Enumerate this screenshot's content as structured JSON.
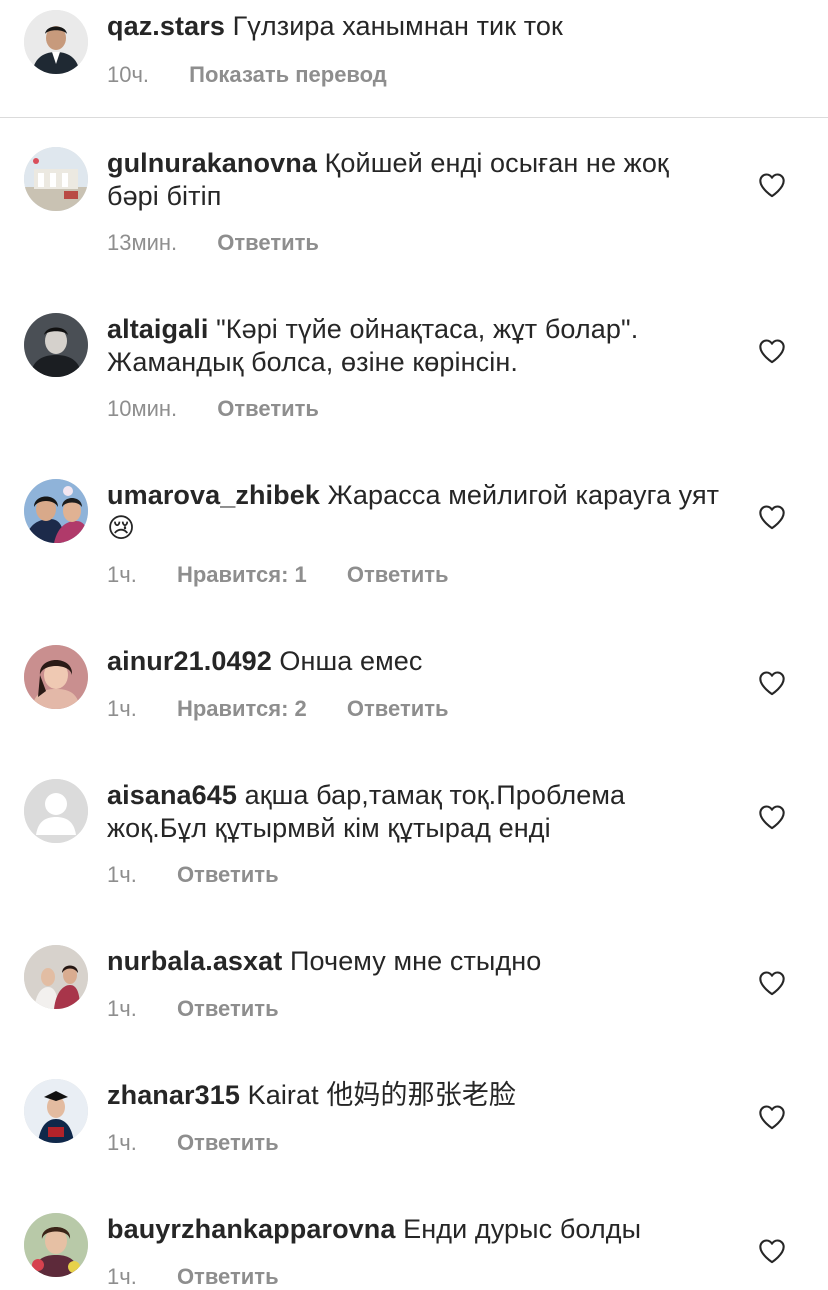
{
  "header_comment": {
    "username": "qaz.stars",
    "text": "Гүлзира ханымнан тик ток",
    "time": "10ч.",
    "action": "Показать перевод"
  },
  "comments": [
    {
      "username": "gulnurakanovna",
      "text": "Қойшей енді осыған не жоқ бәрі бітіп",
      "time": "13мин.",
      "likes": "",
      "reply": "Ответить"
    },
    {
      "username": "altaigali",
      "text": "\"Кәрі түйе ойнақтаса, жұт болар\". Жамандық болса, өзіне көрінсін.",
      "time": "10мин.",
      "likes": "",
      "reply": "Ответить"
    },
    {
      "username": "umarova_zhibek",
      "text": "Жарасса мейлигой карауга уят😢",
      "time": "1ч.",
      "likes": "Нравится: 1",
      "reply": "Ответить"
    },
    {
      "username": "ainur21.0492",
      "text": "Онша емес",
      "time": "1ч.",
      "likes": "Нравится: 2",
      "reply": "Ответить"
    },
    {
      "username": "aisana645",
      "text": "ақша бар,тамақ тоқ.Проблема жоқ.Бұл құтырмвй кім құтырад енді",
      "time": "1ч.",
      "likes": "",
      "reply": "Ответить"
    },
    {
      "username": "nurbala.asxat",
      "text": "Почему мне стыдно",
      "time": "1ч.",
      "likes": "",
      "reply": "Ответить"
    },
    {
      "username": "zhanar315",
      "text": "Kairat 他妈的那张老脸",
      "time": "1ч.",
      "likes": "",
      "reply": "Ответить"
    },
    {
      "username": "bauyrzhankapparovna",
      "text": "Енди дурыс болды",
      "time": "1ч.",
      "likes": "",
      "reply": "Ответить"
    }
  ],
  "colors": {
    "text": "#262626",
    "secondary": "#8e8e8e",
    "divider": "#dbdbdb"
  }
}
